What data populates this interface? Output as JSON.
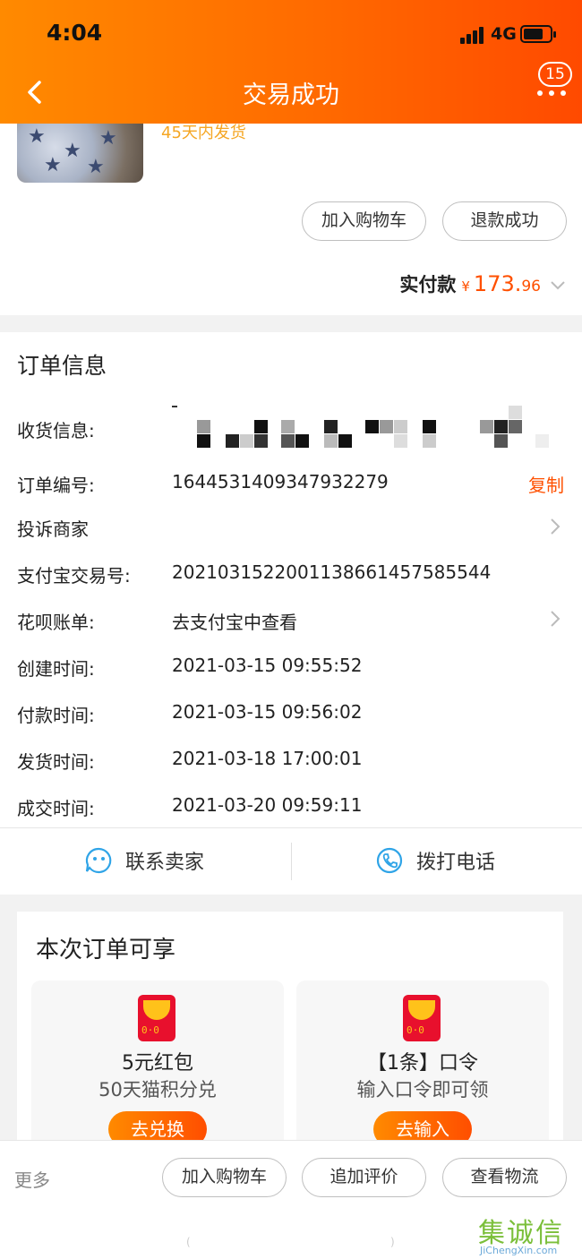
{
  "status_bar": {
    "time": "4:04",
    "network": "4G"
  },
  "nav": {
    "title": "交易成功",
    "badge_count": "15"
  },
  "product": {
    "ship_note": "45天内发货",
    "buttons": {
      "add_cart": "加入购物车",
      "refund": "退款成功"
    },
    "paid_label": "实付款",
    "currency": "¥",
    "amount_int": "173.",
    "amount_dec": "96"
  },
  "order": {
    "title": "订单信息",
    "rows": [
      {
        "label": "收货信息:",
        "value": ""
      },
      {
        "label": "订单编号:",
        "value": "1644531409347932279",
        "action": "复制"
      },
      {
        "label": "投诉商家",
        "value": ""
      },
      {
        "label": "支付宝交易号:",
        "value": "2021031522001138661457585544"
      },
      {
        "label": "花呗账单:",
        "value": "去支付宝中查看"
      },
      {
        "label": "创建时间:",
        "value": "2021-03-15 09:55:52"
      },
      {
        "label": "付款时间:",
        "value": "2021-03-15 09:56:02"
      },
      {
        "label": "发货时间:",
        "value": "2021-03-18 17:00:01"
      },
      {
        "label": "成交时间:",
        "value": "2021-03-20 09:59:11"
      }
    ],
    "actions": {
      "contact_seller": "联系卖家",
      "call": "拨打电话"
    }
  },
  "benefits": {
    "title": "本次订单可享",
    "items": [
      {
        "main": "5元红包",
        "sub": "50天猫积分兑",
        "button": "去兑换"
      },
      {
        "main": "【1条】口令",
        "sub": "输入口令即可领",
        "button": "去输入"
      }
    ]
  },
  "bottom_bar": {
    "more": "更多",
    "add_cart": "加入购物车",
    "add_review": "追加评价",
    "logistics": "查看物流"
  },
  "watermark": {
    "text": "集诚信",
    "sub": "JiChengXin.com"
  },
  "colors": {
    "accent": "#ff5000",
    "header_start": "#ff8a00",
    "header_end": "#ff4a00"
  }
}
